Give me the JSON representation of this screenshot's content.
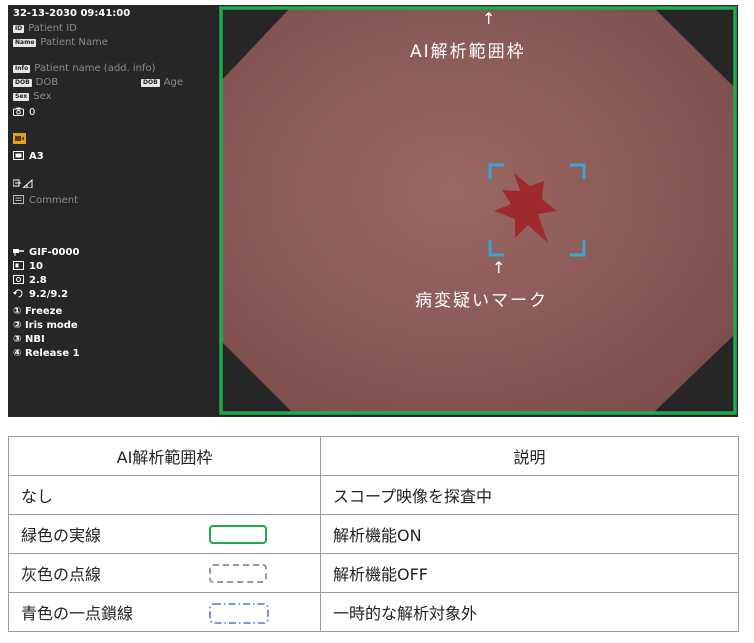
{
  "monitor": {
    "datetime": "32-13-2030   09:41:00",
    "patient_id": "Patient ID",
    "patient_name": "Patient Name",
    "patient_name_add": "Patient name (add. info)",
    "dob": "DOB",
    "age": "Age",
    "sex": "Sex",
    "photo_count": "0",
    "size": "A3",
    "comment": "Comment",
    "scope": "GIF-0000",
    "val1": "10",
    "val2": "2.8",
    "val3": "9.2/9.2",
    "btn1": "① Freeze",
    "btn2": "② Iris mode",
    "btn3": "③ NBI",
    "btn4": "④ Release 1",
    "tags": {
      "id": "ID",
      "name": "Name",
      "info": "Info",
      "dob": "DOB",
      "dob2": "DOB",
      "sex": "Sex"
    },
    "frame_label": "AI解析範囲枠",
    "lesion_label": "病変疑いマーク",
    "arrow": "↑",
    "colors": {
      "frame_green": "#1faa4d",
      "lesion_blue": "#3aa6cf",
      "tissue": "#8a5a57",
      "lesion_red": "#9e2a2e"
    },
    "icons": [
      "camera-icon",
      "size-icon",
      "signal-icon",
      "comment-icon",
      "scope-icon"
    ]
  },
  "legend": {
    "header": {
      "col1": "AI解析範囲枠",
      "col2": "説明"
    },
    "rows": [
      {
        "frame": "なし",
        "sample": "none",
        "desc": "スコープ映像を探査中"
      },
      {
        "frame": "緑色の実線",
        "sample": "green-solid",
        "desc": "解析機能ON"
      },
      {
        "frame": "灰色の点線",
        "sample": "gray-dashed",
        "desc": "解析機能OFF"
      },
      {
        "frame": "青色の一点鎖線",
        "sample": "blue-dashdot",
        "desc": "一時的な解析対象外"
      }
    ]
  }
}
